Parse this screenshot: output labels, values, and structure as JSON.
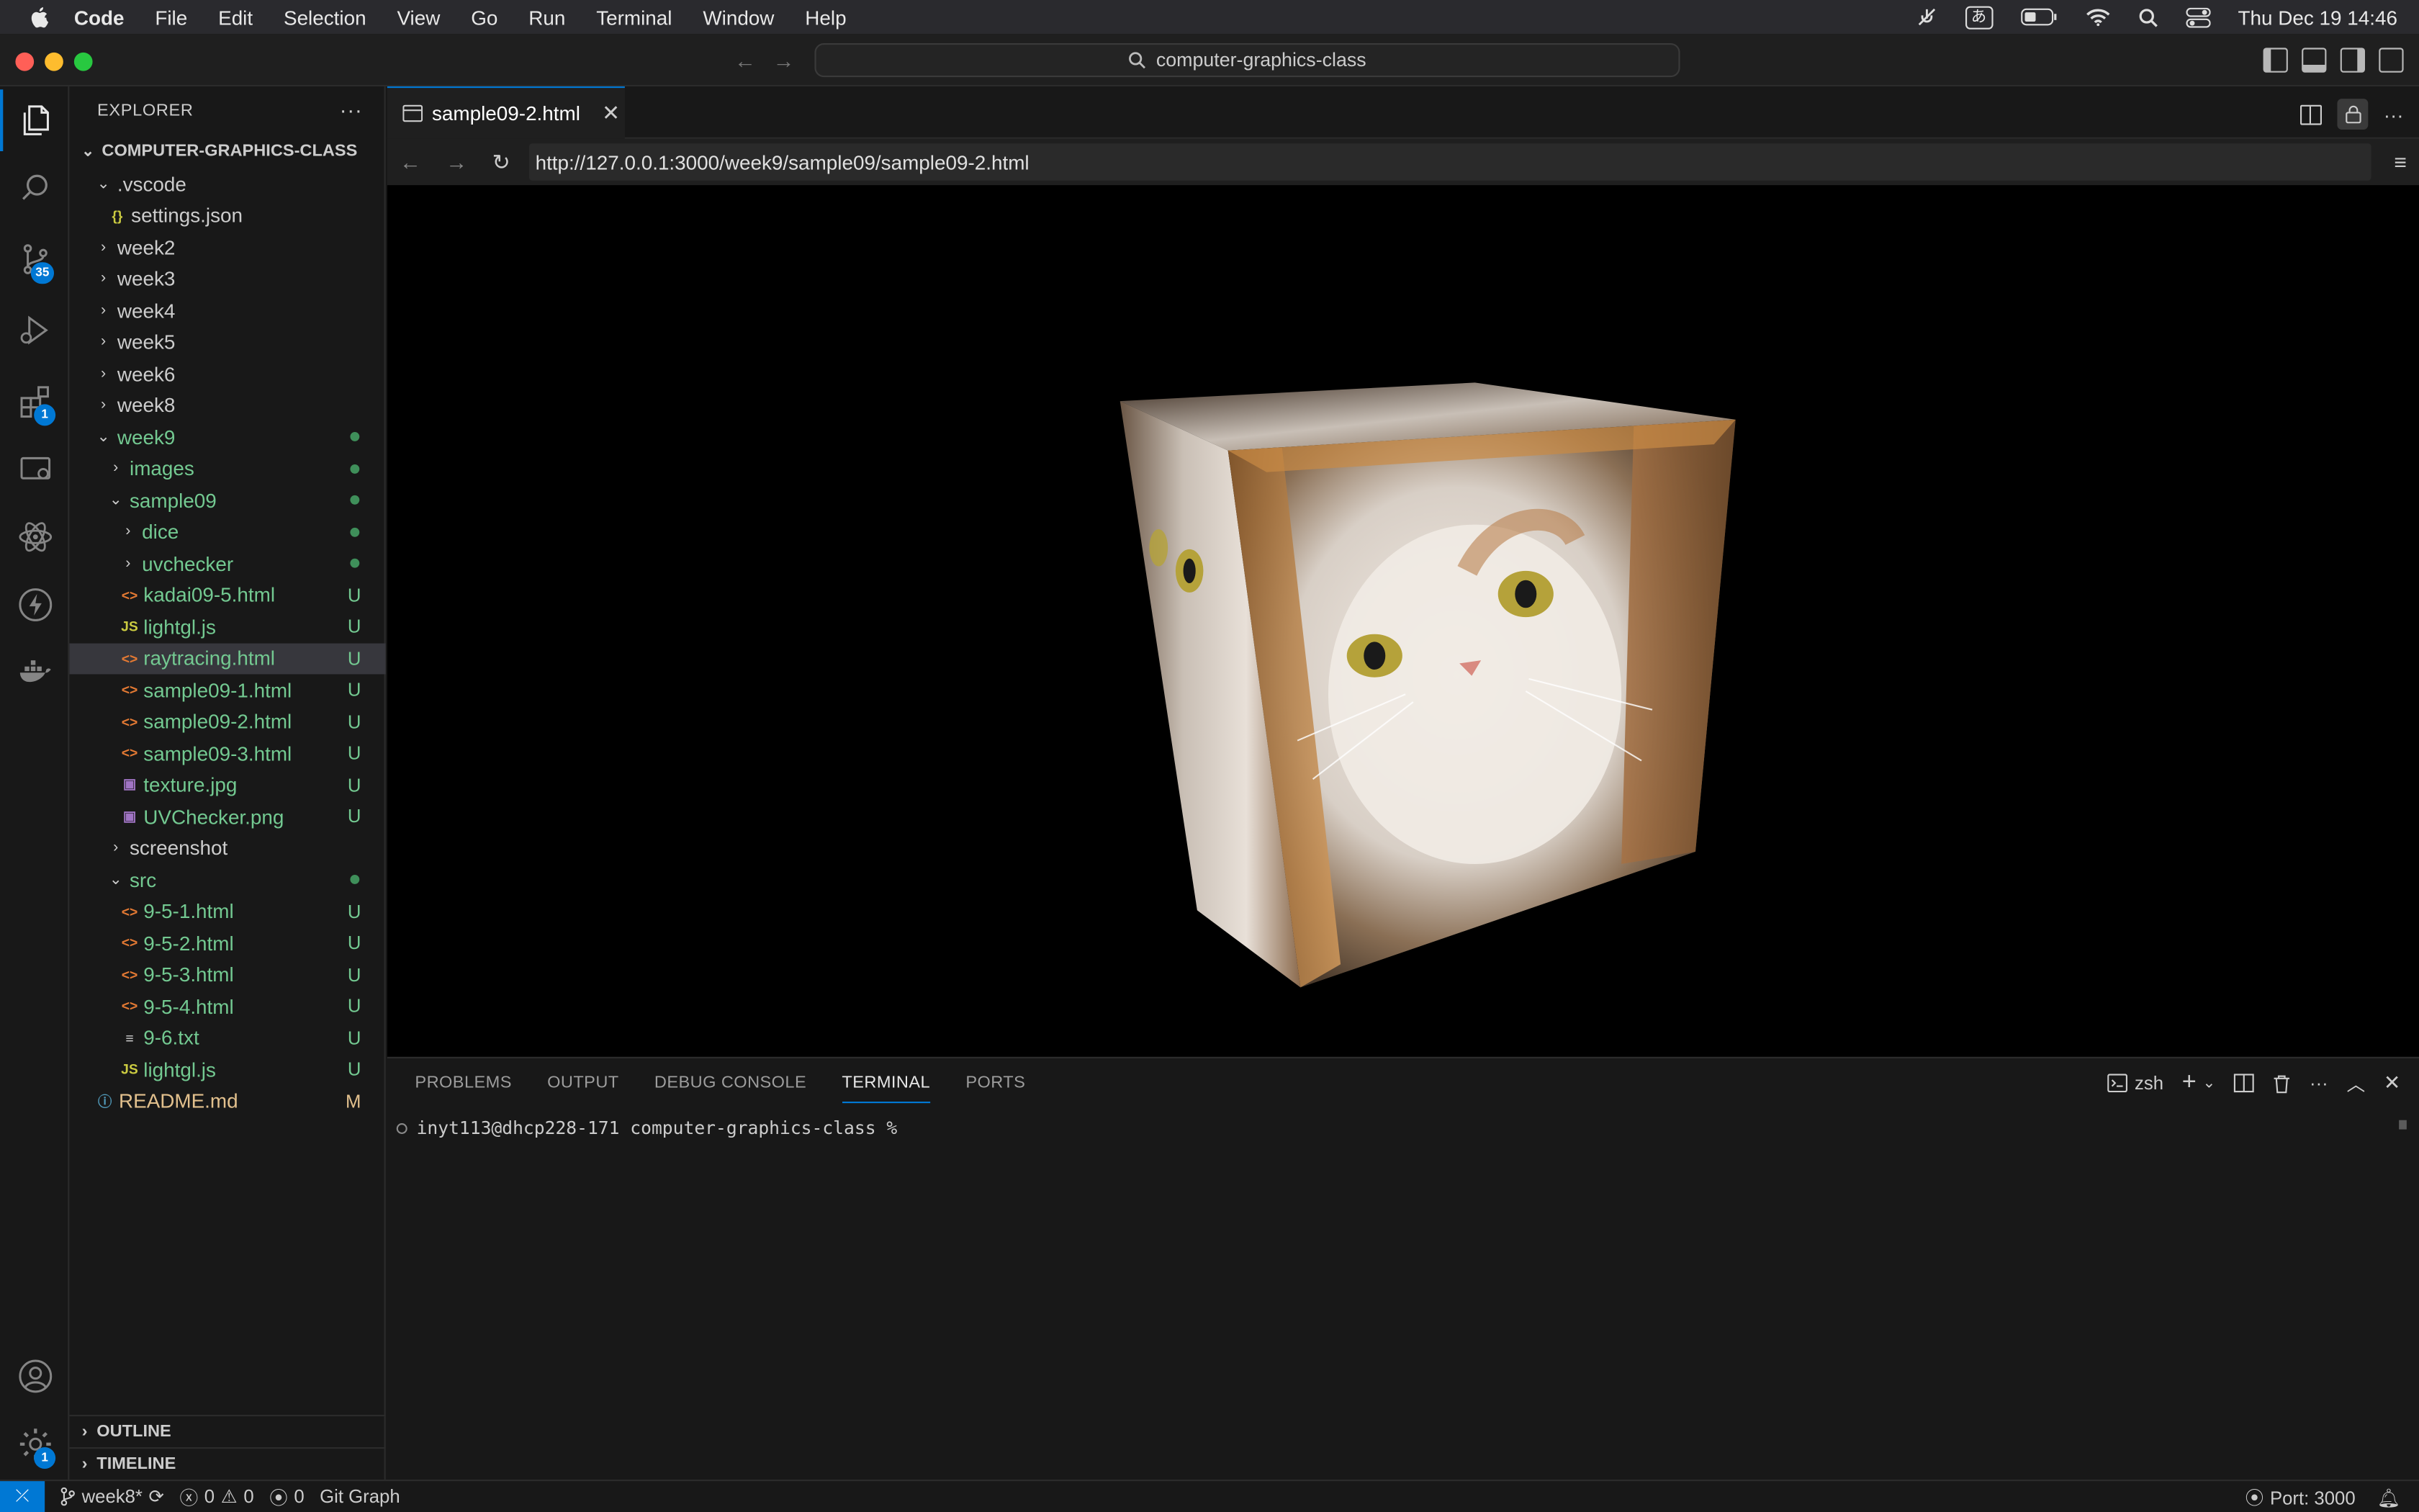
{
  "menubar": {
    "app": "Code",
    "items": [
      "File",
      "Edit",
      "Selection",
      "View",
      "Go",
      "Run",
      "Terminal",
      "Window",
      "Help"
    ],
    "ime": "あ",
    "clock": "Thu Dec 19  14:46"
  },
  "titlebar": {
    "search": "computer-graphics-class"
  },
  "activity": {
    "scm_badge": "35",
    "ext_badge": "1",
    "settings_badge": "1"
  },
  "sidebar": {
    "title": "EXPLORER",
    "root": "COMPUTER-GRAPHICS-CLASS",
    "items": [
      {
        "label": ".vscode",
        "icon": "chevron-down",
        "status": ""
      },
      {
        "label": "settings.json",
        "icon": "json",
        "status": ""
      },
      {
        "label": "week2",
        "icon": "chevron-right",
        "status": ""
      },
      {
        "label": "week3",
        "icon": "chevron-right",
        "status": ""
      },
      {
        "label": "week4",
        "icon": "chevron-right",
        "status": ""
      },
      {
        "label": "week5",
        "icon": "chevron-right",
        "status": ""
      },
      {
        "label": "week6",
        "icon": "chevron-right",
        "status": ""
      },
      {
        "label": "week8",
        "icon": "chevron-right",
        "status": ""
      },
      {
        "label": "week9",
        "icon": "chevron-down",
        "status": "dot"
      },
      {
        "label": "images",
        "icon": "chevron-right",
        "status": "dot"
      },
      {
        "label": "sample09",
        "icon": "chevron-down",
        "status": "dot"
      },
      {
        "label": "dice",
        "icon": "chevron-right",
        "status": "dot"
      },
      {
        "label": "uvchecker",
        "icon": "chevron-right",
        "status": "dot"
      },
      {
        "label": "kadai09-5.html",
        "icon": "html",
        "status": "U"
      },
      {
        "label": "lightgl.js",
        "icon": "js",
        "status": "U"
      },
      {
        "label": "raytracing.html",
        "icon": "html",
        "status": "U"
      },
      {
        "label": "sample09-1.html",
        "icon": "html",
        "status": "U"
      },
      {
        "label": "sample09-2.html",
        "icon": "html",
        "status": "U"
      },
      {
        "label": "sample09-3.html",
        "icon": "html",
        "status": "U"
      },
      {
        "label": "texture.jpg",
        "icon": "image",
        "status": "U"
      },
      {
        "label": "UVChecker.png",
        "icon": "image",
        "status": "U"
      },
      {
        "label": "screenshot",
        "icon": "chevron-right",
        "status": ""
      },
      {
        "label": "src",
        "icon": "chevron-down",
        "status": "dot"
      },
      {
        "label": "9-5-1.html",
        "icon": "html",
        "status": "U"
      },
      {
        "label": "9-5-2.html",
        "icon": "html",
        "status": "U"
      },
      {
        "label": "9-5-3.html",
        "icon": "html",
        "status": "U"
      },
      {
        "label": "9-5-4.html",
        "icon": "html",
        "status": "U"
      },
      {
        "label": "9-6.txt",
        "icon": "text",
        "status": "U"
      },
      {
        "label": "lightgl.js",
        "icon": "js",
        "status": "U"
      },
      {
        "label": "README.md",
        "icon": "info",
        "status": "M"
      }
    ],
    "outline": "OUTLINE",
    "timeline": "TIMELINE"
  },
  "editor": {
    "tab": "sample09-2.html",
    "url": "http://127.0.0.1:3000/week9/sample09/sample09-2.html"
  },
  "panel": {
    "tabs": [
      "PROBLEMS",
      "OUTPUT",
      "DEBUG CONSOLE",
      "TERMINAL",
      "PORTS"
    ],
    "shell": "zsh",
    "prompt": "inyt113@dhcp228-171 computer-graphics-class %"
  },
  "status": {
    "branch": "week8*",
    "errors": "0",
    "warnings": "0",
    "ports": "0",
    "git_graph": "Git Graph",
    "port": "Port: 3000"
  },
  "colors": {
    "accent": "#0078d4",
    "untracked": "#73c991",
    "modified": "#e2c08d"
  }
}
